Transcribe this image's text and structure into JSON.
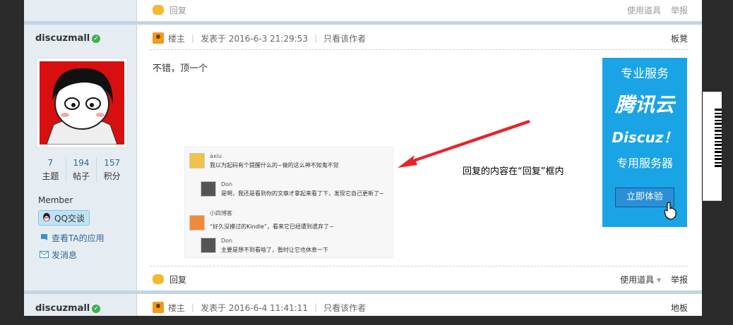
{
  "prev_post": {
    "reply_label": "回复",
    "tools_label": "使用道具",
    "report_label": "举报"
  },
  "user1": {
    "name": "discuzmall",
    "stats": [
      {
        "num": "7",
        "label": "主题"
      },
      {
        "num": "194",
        "label": "帖子"
      },
      {
        "num": "157",
        "label": "积分"
      }
    ],
    "group": "Member",
    "qq_label": "QQ交谈",
    "apps_link": "查看TA的应用",
    "message_link": "发消息"
  },
  "post1": {
    "role": "楼主",
    "posted_at": "发表于 2016-6-3 21:29:53",
    "only_author": "只看该作者",
    "floor": "板凳",
    "body": "不错，顶一个",
    "annotation": "回复的内容在“回复”框内",
    "reply_label": "回复",
    "tools_label": "使用道具",
    "report_label": "举报"
  },
  "embedded_replies": [
    {
      "user": "axiu",
      "text": "我以为起码有个提醒什么的~做的这么神不知鬼不觉"
    },
    {
      "user": "Don",
      "text": "是啊，我还是看到你的文章才拿起来看了下，发现它自己更新了~"
    },
    {
      "user": "小四博客",
      "text": "“好久没摸过的Kindle”，看来它已经遭到遗弃了~"
    },
    {
      "user": "Don",
      "text": "主要是想不到看啥了，暂时让它也休息一下"
    }
  ],
  "ad": {
    "line1": "专业服务",
    "line2": "腾讯云",
    "line3": "Discuz！",
    "line4": "专用服务器",
    "button": "立即体验"
  },
  "user2": {
    "name": "discuzmall"
  },
  "post2": {
    "role": "楼主",
    "posted_at": "发表于 2016-6-4 11:41:11",
    "only_author": "只看该作者",
    "floor": "地板"
  },
  "colors": {
    "link": "#336699",
    "sidebar": "#e5edf2",
    "ad_bg": "#1aa4e6",
    "arrow": "#e8232a"
  }
}
